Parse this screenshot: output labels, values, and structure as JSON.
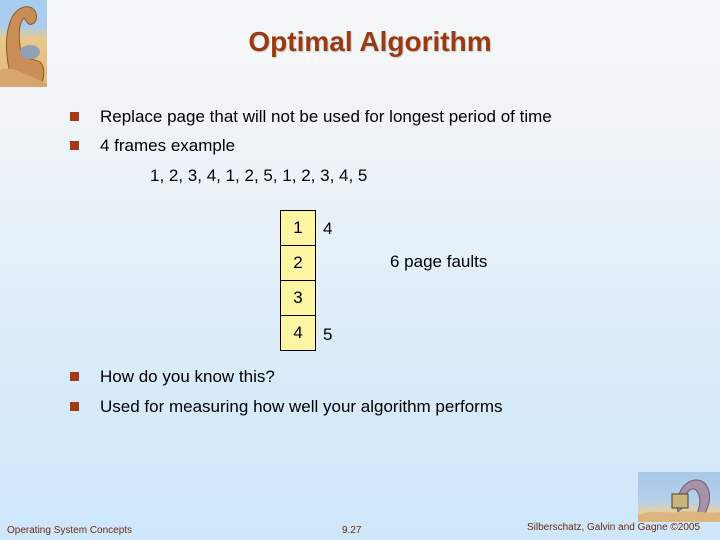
{
  "slide": {
    "title": "Optimal Algorithm",
    "bullets": [
      "Replace page that will not be used for longest period of time",
      "4 frames example",
      "How do you know this?",
      "Used for measuring how well your algorithm performs"
    ],
    "reference_string": "1, 2, 3, 4, 1, 2, 5, 1, 2, 3, 4, 5",
    "frames": [
      "1",
      "2",
      "3",
      "4"
    ],
    "replacements": {
      "frame1": "4",
      "frame4": "5"
    },
    "page_faults_label": "6 page faults"
  },
  "footer": {
    "left": "Operating System Concepts",
    "center": "9.27",
    "right": "Silberschatz, Galvin and Gagne ©2005"
  },
  "colors": {
    "title": "#9b3a12",
    "bullet": "#a33a14",
    "frame_fill": "#fef6a3"
  },
  "icons": {
    "top_left": "dinosaur-logo",
    "bottom_right": "dinosaur-computer-logo"
  }
}
